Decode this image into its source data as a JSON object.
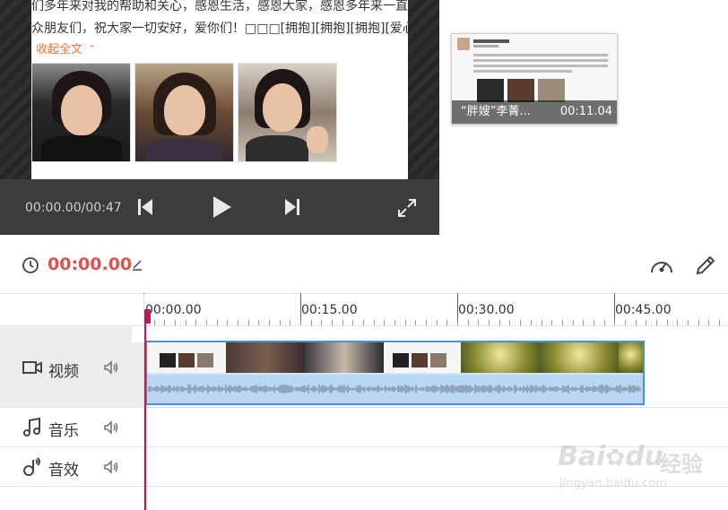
{
  "preview": {
    "post_line_1": "们多年来对我的帮助和关心，感恩生活，感恩大家，感恩多年来一直",
    "post_line_2": "众朋友们，祝大家一切安好，爱你们！□□□[拥抱][拥抱][拥抱][爱心][",
    "collapse_label": "收起全文",
    "collapse_icon": "chevron-up-icon"
  },
  "player": {
    "time_readout": "00:00.00/00:47",
    "prev_icon": "skip-back-icon",
    "play_icon": "play-icon",
    "next_icon": "skip-forward-icon",
    "fullscreen_icon": "fullscreen-icon"
  },
  "media": {
    "thumb_title": "“胖嫂”李菁...",
    "thumb_duration": "00:11.04"
  },
  "toolbar": {
    "current_time": "00:00.00",
    "clock_icon": "clock-icon",
    "edit_icon": "pencil-small-icon",
    "speed_icon": "speedometer-icon",
    "pencil_icon": "pencil-icon"
  },
  "ruler": {
    "ticks": [
      "00:00.00",
      "00:15.00",
      "00:30.00",
      "00:45.00"
    ]
  },
  "tracks": {
    "video": {
      "label": "视频",
      "icon": "video-camera-icon",
      "volume_icon": "speaker-icon"
    },
    "music": {
      "label": "音乐",
      "icon": "music-note-icon",
      "volume_icon": "speaker-icon"
    },
    "sfx": {
      "label": "音效",
      "icon": "sound-effect-icon",
      "volume_icon": "speaker-icon"
    }
  },
  "colors": {
    "accent": "#d9534f",
    "clip_border": "#4a90d9",
    "playhead": "#c2185b",
    "collapse_link": "#eb7340"
  },
  "watermark": {
    "brand": "Bai",
    "brand2": "du",
    "brand_cn": "经验",
    "url": "jingyan.baidu.com"
  }
}
